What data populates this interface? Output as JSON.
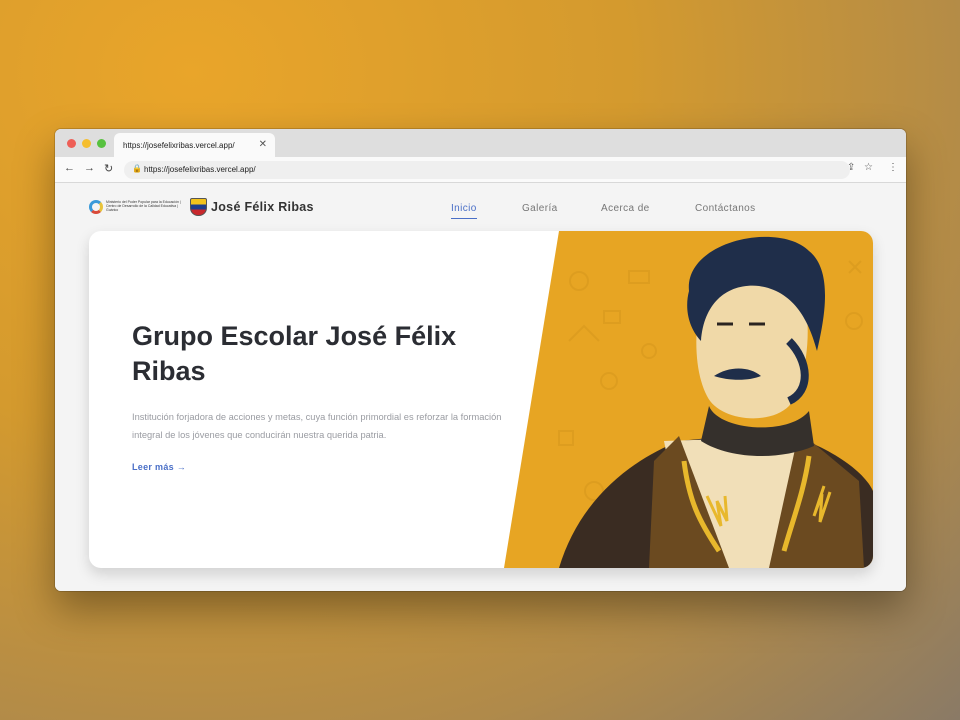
{
  "browser": {
    "tab_title": "https://josefelixribas.vercel.app/",
    "tab_close": "✕",
    "url": "https://josefelixribas.vercel.app/",
    "icons": [
      "back-icon",
      "forward-icon",
      "reload-icon",
      "lock-icon",
      "share-icon",
      "star-icon",
      "menu-icon"
    ]
  },
  "site": {
    "logo_text": "Ministerio del Poder Popular para la Educación | Centro de Desarrollo de la Calidad Educativa | Guárico",
    "brand": "José Félix Ribas",
    "nav": [
      {
        "label": "Inicio",
        "active": true
      },
      {
        "label": "Galería",
        "active": false
      },
      {
        "label": "Acerca de",
        "active": false
      },
      {
        "label": "Contáctanos",
        "active": false
      }
    ],
    "hero": {
      "title": "Grupo Escolar José Félix Ribas",
      "description": "Institución forjadora de acciones y metas, cuya función primordial es reforzar la formación integral de los jóvenes que conducirán nuestra querida patria.",
      "cta": "Leer más →"
    }
  },
  "colors": {
    "accent": "#4a6fc7",
    "hero_yellow": "#e7a523",
    "title": "#2b2d33",
    "background": "#d49a2e"
  }
}
